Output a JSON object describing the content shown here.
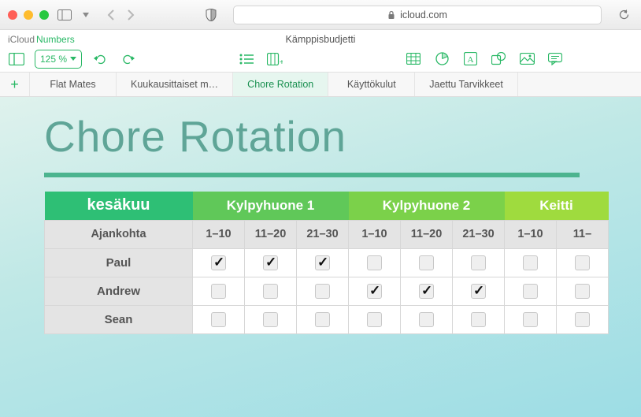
{
  "browser": {
    "url_host": "icloud.com"
  },
  "breadcrumb": {
    "app": "iCloud",
    "module": "Numbers"
  },
  "document_title": "Kämppisbudjetti",
  "zoom": "125 %",
  "sheets": [
    {
      "label": "Flat Mates",
      "active": false
    },
    {
      "label": "Kuukausittaiset m…",
      "active": false
    },
    {
      "label": "Chore Rotation",
      "active": true
    },
    {
      "label": "Käyttökulut",
      "active": false
    },
    {
      "label": "Jaettu Tarvikkeet",
      "active": false
    }
  ],
  "heading": "Chore Rotation",
  "table": {
    "month": "kesäkuu",
    "groups": [
      {
        "label": "Kylpyhuone 1"
      },
      {
        "label": "Kylpyhuone 2"
      },
      {
        "label": "Keitti"
      }
    ],
    "subhead_label": "Ajankohta",
    "ranges": [
      "1–10",
      "11–20",
      "21–30",
      "1–10",
      "11–20",
      "21–30",
      "1–10",
      "11–"
    ],
    "rows": [
      {
        "name": "Paul",
        "checks": [
          true,
          true,
          true,
          false,
          false,
          false,
          false,
          false
        ]
      },
      {
        "name": "Andrew",
        "checks": [
          false,
          false,
          false,
          true,
          true,
          true,
          false,
          false
        ]
      },
      {
        "name": "Sean",
        "checks": [
          false,
          false,
          false,
          false,
          false,
          false,
          false,
          false
        ]
      }
    ]
  }
}
